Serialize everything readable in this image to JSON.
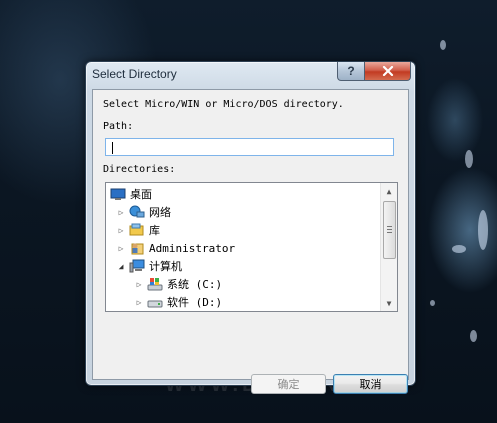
{
  "wallpaper": {
    "watermark": "WWW.DEEPIN.ORG"
  },
  "dialog": {
    "title": "Select Directory",
    "help_button": "?",
    "close_button": "x",
    "instruction": "Select Micro/WIN or Micro/DOS directory.",
    "path_label": "Path:",
    "path_value": "",
    "directories_label": "Directories:",
    "tree": [
      {
        "label": "桌面",
        "expander": "",
        "icon": "desktop-icon"
      },
      {
        "label": "网络",
        "expander": "▷",
        "icon": "network-icon"
      },
      {
        "label": "库",
        "expander": "▷",
        "icon": "library-icon"
      },
      {
        "label": "Administrator",
        "expander": "▷",
        "icon": "user-folder-icon"
      },
      {
        "label": "计算机",
        "expander": "◢",
        "icon": "computer-icon"
      },
      {
        "label": "系统 (C:)",
        "expander": "▷",
        "icon": "system-drive-icon"
      },
      {
        "label": "软件 (D:)",
        "expander": "▷",
        "icon": "drive-icon"
      }
    ],
    "scroll_up": "▲",
    "scroll_down": "▼",
    "ok_button": "确定",
    "cancel_button": "取消"
  }
}
